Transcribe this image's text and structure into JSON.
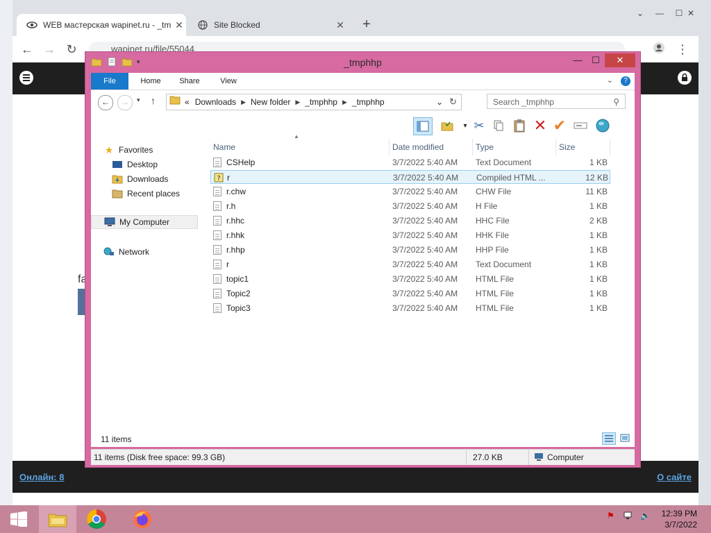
{
  "browser": {
    "tabs": [
      {
        "title": "WEB мастерская wapinet.ru - _tm",
        "active": true
      },
      {
        "title": "Site Blocked",
        "active": false
      }
    ],
    "url": "wapinet.ru/file/55044"
  },
  "site": {
    "online_label": "Онлайн: 8",
    "about_label": "О сайте",
    "fragment_text": "fa"
  },
  "explorer": {
    "title": "_tmphhp",
    "ribbon_tabs": [
      "File",
      "Home",
      "Share",
      "View"
    ],
    "address": {
      "prefix": "«",
      "segments": [
        "Downloads",
        "New folder",
        "_tmphhp",
        "_tmphhp"
      ]
    },
    "search_placeholder": "Search _tmphhp",
    "nav": {
      "favorites": "Favorites",
      "desktop": "Desktop",
      "downloads": "Downloads",
      "recent": "Recent places",
      "computer": "My Computer",
      "network": "Network"
    },
    "columns": {
      "name": "Name",
      "date": "Date modified",
      "type": "Type",
      "size": "Size"
    },
    "files": [
      {
        "name": "CSHelp",
        "date": "3/7/2022 5:40 AM",
        "type": "Text Document",
        "size": "1 KB",
        "icon": "text-file-icon"
      },
      {
        "name": "r",
        "date": "3/7/2022 5:40 AM",
        "type": "Compiled HTML ...",
        "size": "12 KB",
        "icon": "chm-file-icon"
      },
      {
        "name": "r.chw",
        "date": "3/7/2022 5:40 AM",
        "type": "CHW File",
        "size": "11 KB",
        "icon": "file-icon"
      },
      {
        "name": "r.h",
        "date": "3/7/2022 5:40 AM",
        "type": "H File",
        "size": "1 KB",
        "icon": "file-icon"
      },
      {
        "name": "r.hhc",
        "date": "3/7/2022 5:40 AM",
        "type": "HHC File",
        "size": "2 KB",
        "icon": "file-icon"
      },
      {
        "name": "r.hhk",
        "date": "3/7/2022 5:40 AM",
        "type": "HHK File",
        "size": "1 KB",
        "icon": "file-icon"
      },
      {
        "name": "r.hhp",
        "date": "3/7/2022 5:40 AM",
        "type": "HHP File",
        "size": "1 KB",
        "icon": "file-icon"
      },
      {
        "name": "r",
        "date": "3/7/2022 5:40 AM",
        "type": "Text Document",
        "size": "1 KB",
        "icon": "text-file-icon"
      },
      {
        "name": "topic1",
        "date": "3/7/2022 5:40 AM",
        "type": "HTML File",
        "size": "1 KB",
        "icon": "html-file-icon"
      },
      {
        "name": "Topic2",
        "date": "3/7/2022 5:40 AM",
        "type": "HTML File",
        "size": "1 KB",
        "icon": "html-file-icon"
      },
      {
        "name": "Topic3",
        "date": "3/7/2022 5:40 AM",
        "type": "HTML File",
        "size": "1 KB",
        "icon": "html-file-icon"
      }
    ],
    "item_count": "11 items",
    "status_disk": "11 items (Disk free space: 99.3 GB)",
    "status_size": "27.0 KB",
    "status_location": "Computer"
  },
  "taskbar": {
    "time": "12:39 PM",
    "date": "3/7/2022"
  }
}
